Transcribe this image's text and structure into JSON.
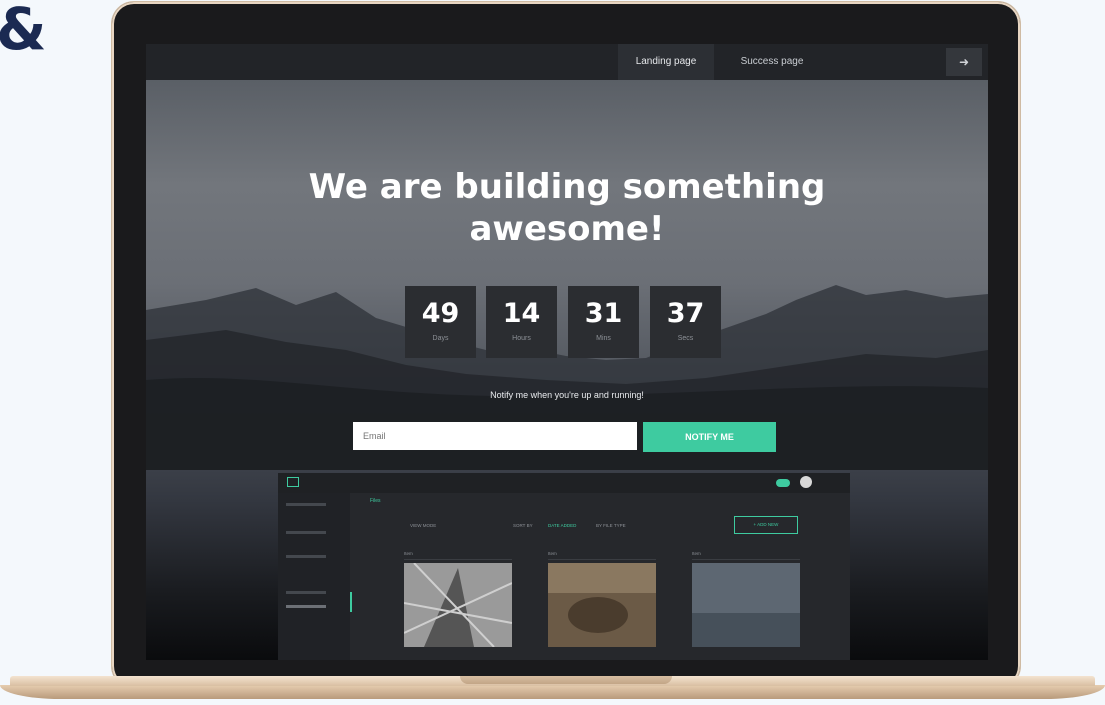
{
  "decor": {
    "ampersand": "&"
  },
  "nav": {
    "tabs": [
      {
        "label": "Landing page",
        "active": true
      },
      {
        "label": "Success page",
        "active": false
      }
    ],
    "icon": "sign-in-icon"
  },
  "hero": {
    "title_line1": "We are building something",
    "title_line2": "awesome!",
    "countdown": [
      {
        "value": "49",
        "unit": "Days"
      },
      {
        "value": "14",
        "unit": "Hours"
      },
      {
        "value": "31",
        "unit": "Mins"
      },
      {
        "value": "37",
        "unit": "Secs"
      }
    ],
    "notify_text": "Notify me when you're up and running!",
    "email_placeholder": "Email",
    "notify_button": "NOTIFY ME"
  },
  "preview": {
    "accent": "#3ecba0",
    "breadcrumb": "Files",
    "filters": [
      "VIEW MODE",
      "SORT BY",
      "DATE ADDED",
      "BY FILE TYPE"
    ],
    "add_button": "+ ADD NEW",
    "cards": [
      {
        "title": "Item"
      },
      {
        "title": "Item"
      },
      {
        "title": "Item"
      }
    ]
  },
  "colors": {
    "accent": "#3ecba0",
    "nav_bg": "#222428",
    "box_bg": "#2b2d31",
    "laptop_trim": "#e8d6c2"
  }
}
